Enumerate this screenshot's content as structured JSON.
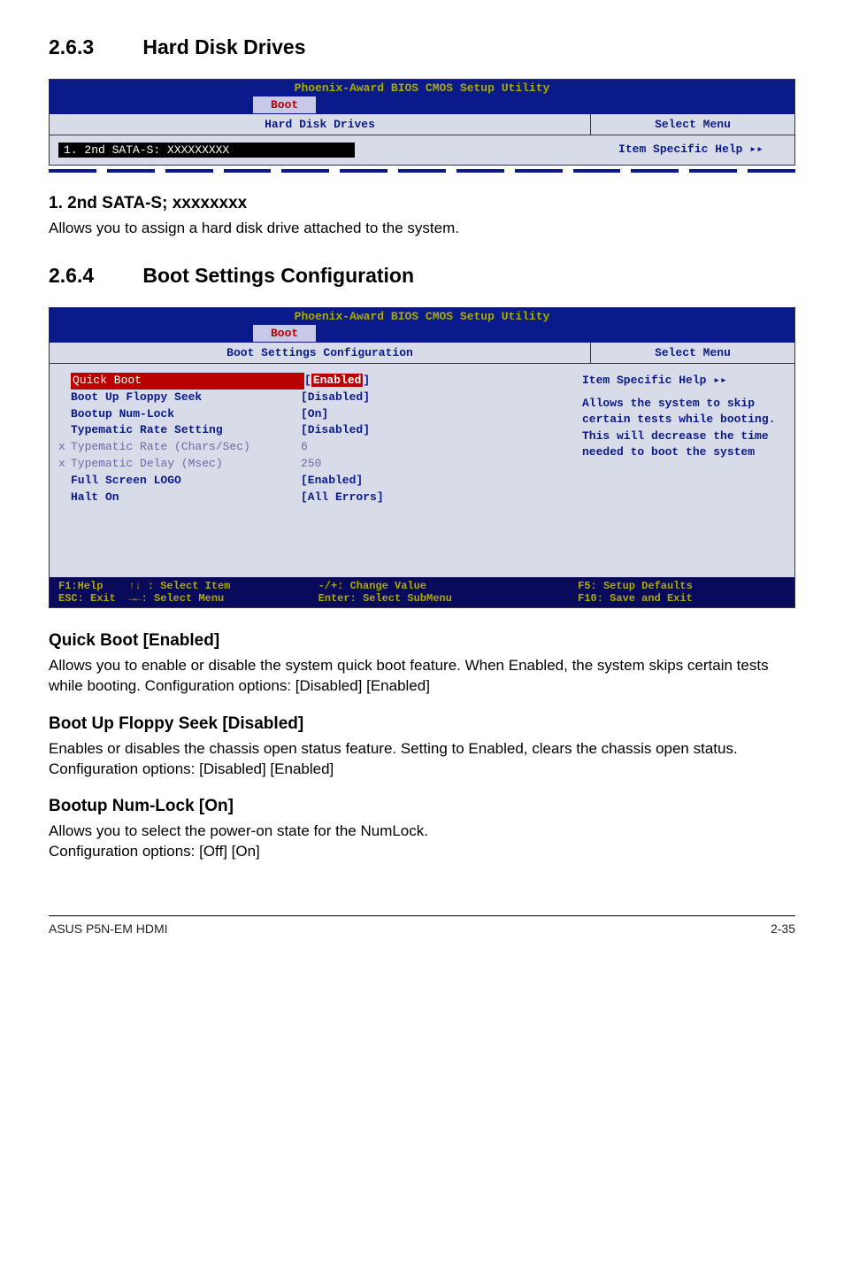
{
  "section1": {
    "number": "2.6.3",
    "title": "Hard Disk Drives"
  },
  "bios1": {
    "window_title": "Phoenix-Award BIOS CMOS Setup Utility",
    "tab": "Boot",
    "left_header": "Hard Disk Drives",
    "right_header": "Select Menu",
    "item": "1. 2nd SATA-S: XXXXXXXXX",
    "help": "Item Specific Help ▸▸"
  },
  "sub1": {
    "head": "1. 2nd SATA-S; xxxxxxxx",
    "text": "Allows you to assign a hard disk drive attached to the system."
  },
  "section2": {
    "number": "2.6.4",
    "title": "Boot Settings Configuration"
  },
  "bios2": {
    "window_title": "Phoenix-Award BIOS CMOS Setup Utility",
    "tab": "Boot",
    "left_header": "Boot Settings Configuration",
    "right_header": "Select Menu",
    "rows": [
      {
        "prefix": "",
        "label": "Quick Boot",
        "value": "[Enabled]",
        "state": "quick"
      },
      {
        "prefix": "",
        "label": "Boot Up Floppy Seek",
        "value": "[Disabled]",
        "state": "main"
      },
      {
        "prefix": "",
        "label": "Bootup Num-Lock",
        "value": "[On]",
        "state": "main"
      },
      {
        "prefix": "",
        "label": "Typematic Rate Setting",
        "value": "[Disabled]",
        "state": "main"
      },
      {
        "prefix": "x",
        "label": "Typematic Rate (Chars/Sec)",
        "value": " 6",
        "state": "faded"
      },
      {
        "prefix": "x",
        "label": "Typematic Delay (Msec)",
        "value": " 250",
        "state": "faded"
      },
      {
        "prefix": "",
        "label": "Full Screen LOGO",
        "value": "[Enabled]",
        "state": "main"
      },
      {
        "prefix": "",
        "label": "Halt On",
        "value": "[All Errors]",
        "state": "main"
      }
    ],
    "help_title": "Item Specific Help ▸▸",
    "help_body": "Allows the system to skip certain tests while booting. This will decrease the time needed to boot the system",
    "footer": {
      "c1a": "F1:Help    ↑↓ : Select Item",
      "c1b": "ESC: Exit  →←: Select Menu",
      "c2a": "-/+: Change Value",
      "c2b": "Enter: Select SubMenu",
      "c3a": "F5: Setup Defaults",
      "c3b": "F10: Save and Exit"
    }
  },
  "quickboot": {
    "head": "Quick Boot [Enabled]",
    "text": "Allows you to enable or disable the system quick boot feature. When Enabled, the system skips certain tests while booting. Configuration options: [Disabled] [Enabled]"
  },
  "floppy": {
    "head": "Boot Up Floppy Seek [Disabled]",
    "text": "Enables or disables the chassis open status feature. Setting to Enabled, clears the chassis open status. Configuration options: [Disabled] [Enabled]"
  },
  "numlock": {
    "head": "Bootup Num-Lock [On]",
    "text1": "Allows you to select the power-on state for the NumLock.",
    "text2": "Configuration options: [Off] [On]"
  },
  "footer": {
    "left": "ASUS P5N-EM HDMI",
    "right": "2-35"
  }
}
